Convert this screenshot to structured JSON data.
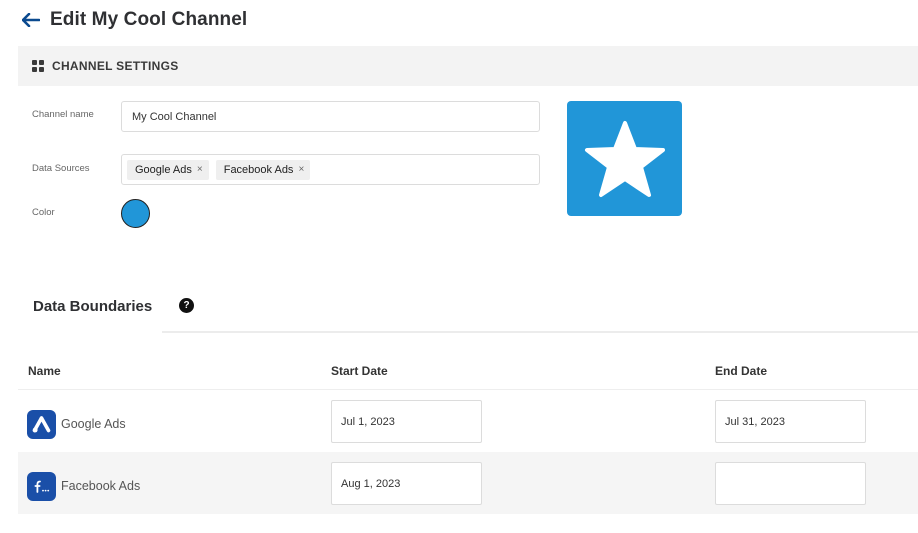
{
  "header": {
    "title": "Edit My Cool Channel",
    "back_icon": "arrow-left-icon"
  },
  "colors": {
    "accent": "#2196d8",
    "brand_blue": "#1a4fa8",
    "title_blue": "#0b4a8f"
  },
  "section": {
    "title": "CHANNEL SETTINGS",
    "icon": "grid-icon"
  },
  "settings": {
    "name_label": "Channel name",
    "name_value": "My Cool Channel",
    "sources_label": "Data Sources",
    "sources": [
      {
        "label": "Google Ads",
        "remove": "×"
      },
      {
        "label": "Facebook Ads",
        "remove": "×"
      }
    ],
    "color_label": "Color",
    "color_value": "#2196d8",
    "channel_icon": "star-icon"
  },
  "boundaries": {
    "title": "Data Boundaries",
    "help": "?",
    "columns": {
      "name": "Name",
      "start": "Start Date",
      "end": "End Date"
    },
    "rows": [
      {
        "name": "Google Ads",
        "logo": "google-ads-logo",
        "start": "Jul 1, 2023",
        "end": "Jul 31, 2023"
      },
      {
        "name": "Facebook Ads",
        "logo": "facebook-ads-logo",
        "start": "Aug 1, 2023",
        "end": ""
      }
    ]
  }
}
